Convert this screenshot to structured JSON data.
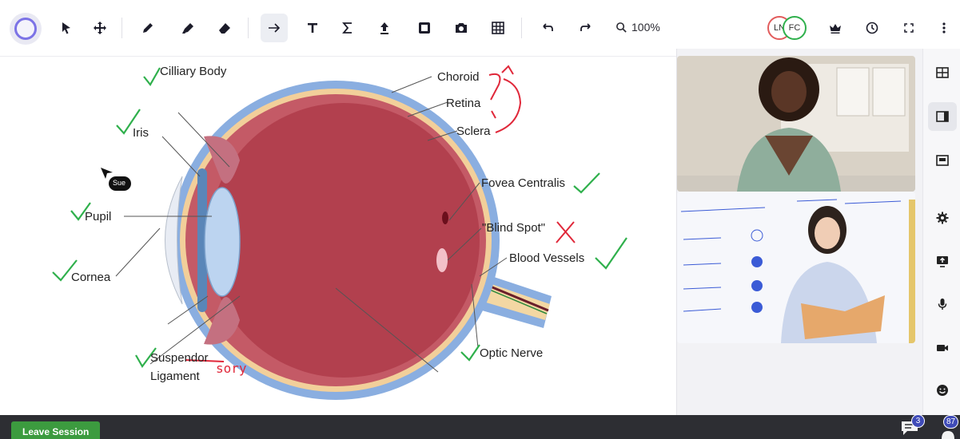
{
  "toolbar": {
    "tools": [
      "circle",
      "pointer",
      "move",
      "pen",
      "highlighter",
      "eraser",
      "arrow",
      "text",
      "equation",
      "upload",
      "bookmark",
      "camera",
      "grid",
      "undo",
      "redo"
    ],
    "zoom_label": "100%",
    "participants": [
      {
        "initials": "LN",
        "ring_color": "#e25c5c"
      },
      {
        "initials": "FC",
        "ring_color": "#2fb04c"
      }
    ],
    "right_tools": [
      "crown",
      "clock",
      "fullscreen",
      "more"
    ]
  },
  "diagram": {
    "labels": {
      "ciliary": "Cilliary Body",
      "iris": "Iris",
      "pupil": "Pupil",
      "cornea": "Cornea",
      "suspensory": "Suspendor",
      "ligament": "Ligament",
      "choroid": "Choroid",
      "retina": "Retina",
      "sclera": "Sclera",
      "fovea": "Fovea Centralis",
      "blind_spot": "\"Blind Spot\"",
      "blood_vessels": "Blood Vessels",
      "optic_nerve": "Optic Nerve"
    },
    "annotation_handwritten": "sory",
    "cursor_label": "Sue",
    "colors": {
      "check": "#2fb04c",
      "correction": "#e0283a",
      "sclera": "#8aaee0",
      "retina_fill": "#b2404e"
    }
  },
  "videos": [
    {
      "name": "participant-video-1"
    },
    {
      "name": "teacher-video"
    }
  ],
  "rail": {
    "buttons": [
      "layout-grid",
      "layout-sidebar",
      "layout-pip",
      "settings",
      "screen-share",
      "microphone",
      "camera",
      "emoji"
    ]
  },
  "bottom_bar": {
    "leave_label": "Leave Session",
    "chat_count": "3",
    "participants_count": "87"
  }
}
